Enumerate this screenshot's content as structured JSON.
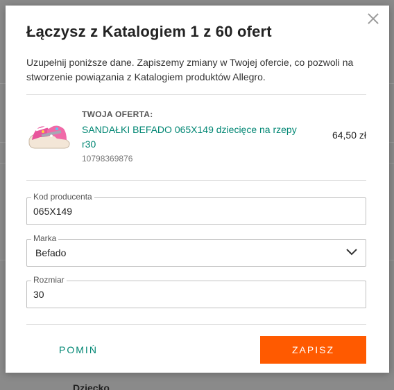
{
  "modal": {
    "title": "Łączysz z Katalogiem 1 z 60 ofert",
    "description": "Uzupełnij poniższe dane. Zapiszemy zmiany w Twojej ofercie, co pozwoli na stworzenie powiązania z Katalogiem produktów Allegro.",
    "close_icon": "close-icon"
  },
  "offer": {
    "heading": "TWOJA OFERTA:",
    "title": "SANDAŁKI BEFADO 065X149 dziecięce na rzepy r30",
    "id": "10798369876",
    "price": "64,50 zł",
    "image_icon": "sandal-image"
  },
  "fields": {
    "producer_code": {
      "label": "Kod producenta",
      "value": "065X149"
    },
    "brand": {
      "label": "Marka",
      "value": "Befado",
      "icon": "chevron-down-icon"
    },
    "size": {
      "label": "Rozmiar",
      "value": "30"
    }
  },
  "actions": {
    "skip_label": "POMIŃ",
    "save_label": "ZAPISZ"
  },
  "background": {
    "bottom_label": "Dziecko"
  },
  "colors": {
    "accent": "#ff5a00",
    "link": "#008673",
    "overlay": "#7f7f7f"
  }
}
